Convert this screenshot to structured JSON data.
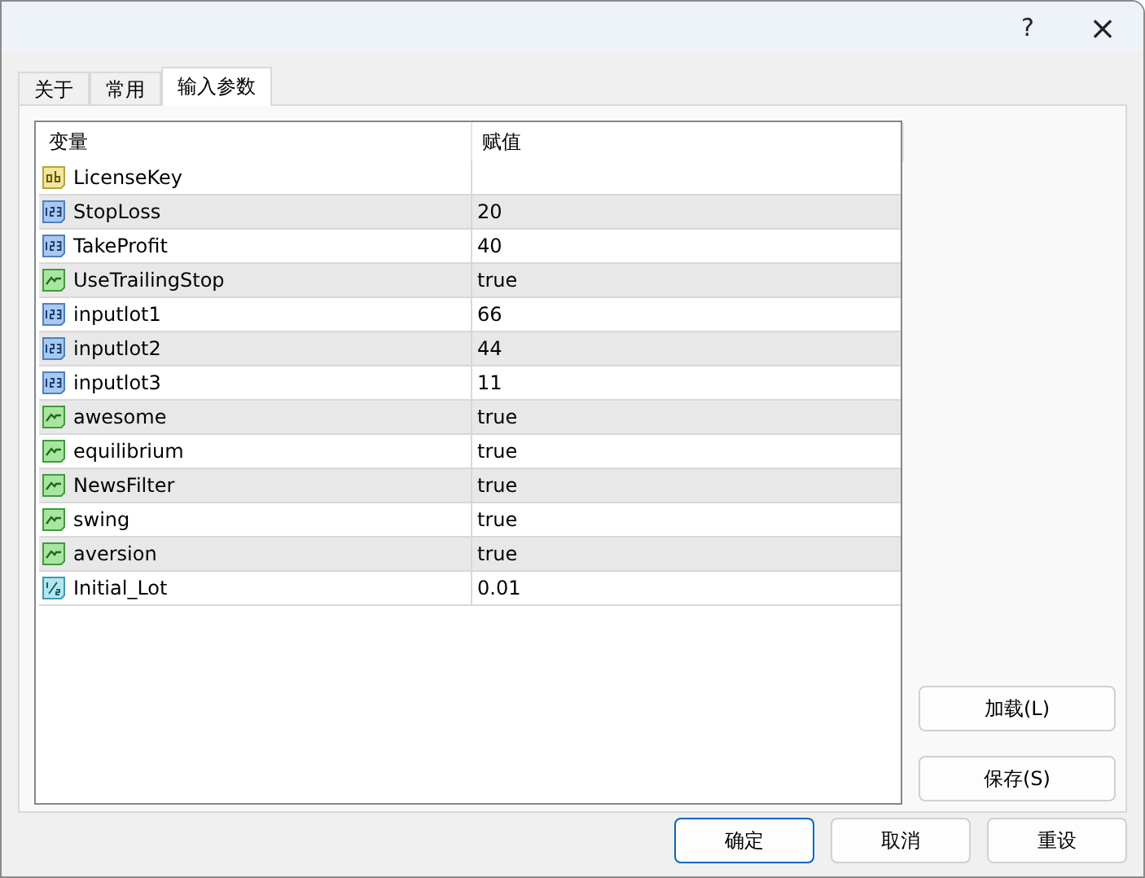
{
  "window": {
    "help": "?",
    "close": "×"
  },
  "tabs": [
    {
      "label": "关于",
      "selected": false
    },
    {
      "label": "常用",
      "selected": false
    },
    {
      "label": "输入参数",
      "selected": true
    }
  ],
  "table": {
    "columns": [
      "变量",
      "赋值"
    ],
    "rows": [
      {
        "kind": "string",
        "name": "LicenseKey",
        "value": ""
      },
      {
        "kind": "integer",
        "name": "StopLoss",
        "value": "20"
      },
      {
        "kind": "integer",
        "name": "TakeProfit",
        "value": "40"
      },
      {
        "kind": "boolean",
        "name": "UseTrailingStop",
        "value": "true"
      },
      {
        "kind": "integer",
        "name": "inputlot1",
        "value": "66"
      },
      {
        "kind": "integer",
        "name": "inputlot2",
        "value": "44"
      },
      {
        "kind": "integer",
        "name": "inputlot3",
        "value": "11"
      },
      {
        "kind": "boolean",
        "name": "awesome",
        "value": "true"
      },
      {
        "kind": "boolean",
        "name": "equilibrium",
        "value": "true"
      },
      {
        "kind": "boolean",
        "name": "NewsFilter",
        "value": "true"
      },
      {
        "kind": "boolean",
        "name": "swing",
        "value": "true"
      },
      {
        "kind": "boolean",
        "name": "aversion",
        "value": "true"
      },
      {
        "kind": "double",
        "name": "Initial_Lot",
        "value": "0.01"
      }
    ]
  },
  "side_buttons": [
    "加载(L)",
    "保存(S)"
  ],
  "buttons": [
    {
      "label": "确定",
      "default": true
    },
    {
      "label": "取消",
      "default": false
    },
    {
      "label": "重设",
      "default": false
    }
  ]
}
